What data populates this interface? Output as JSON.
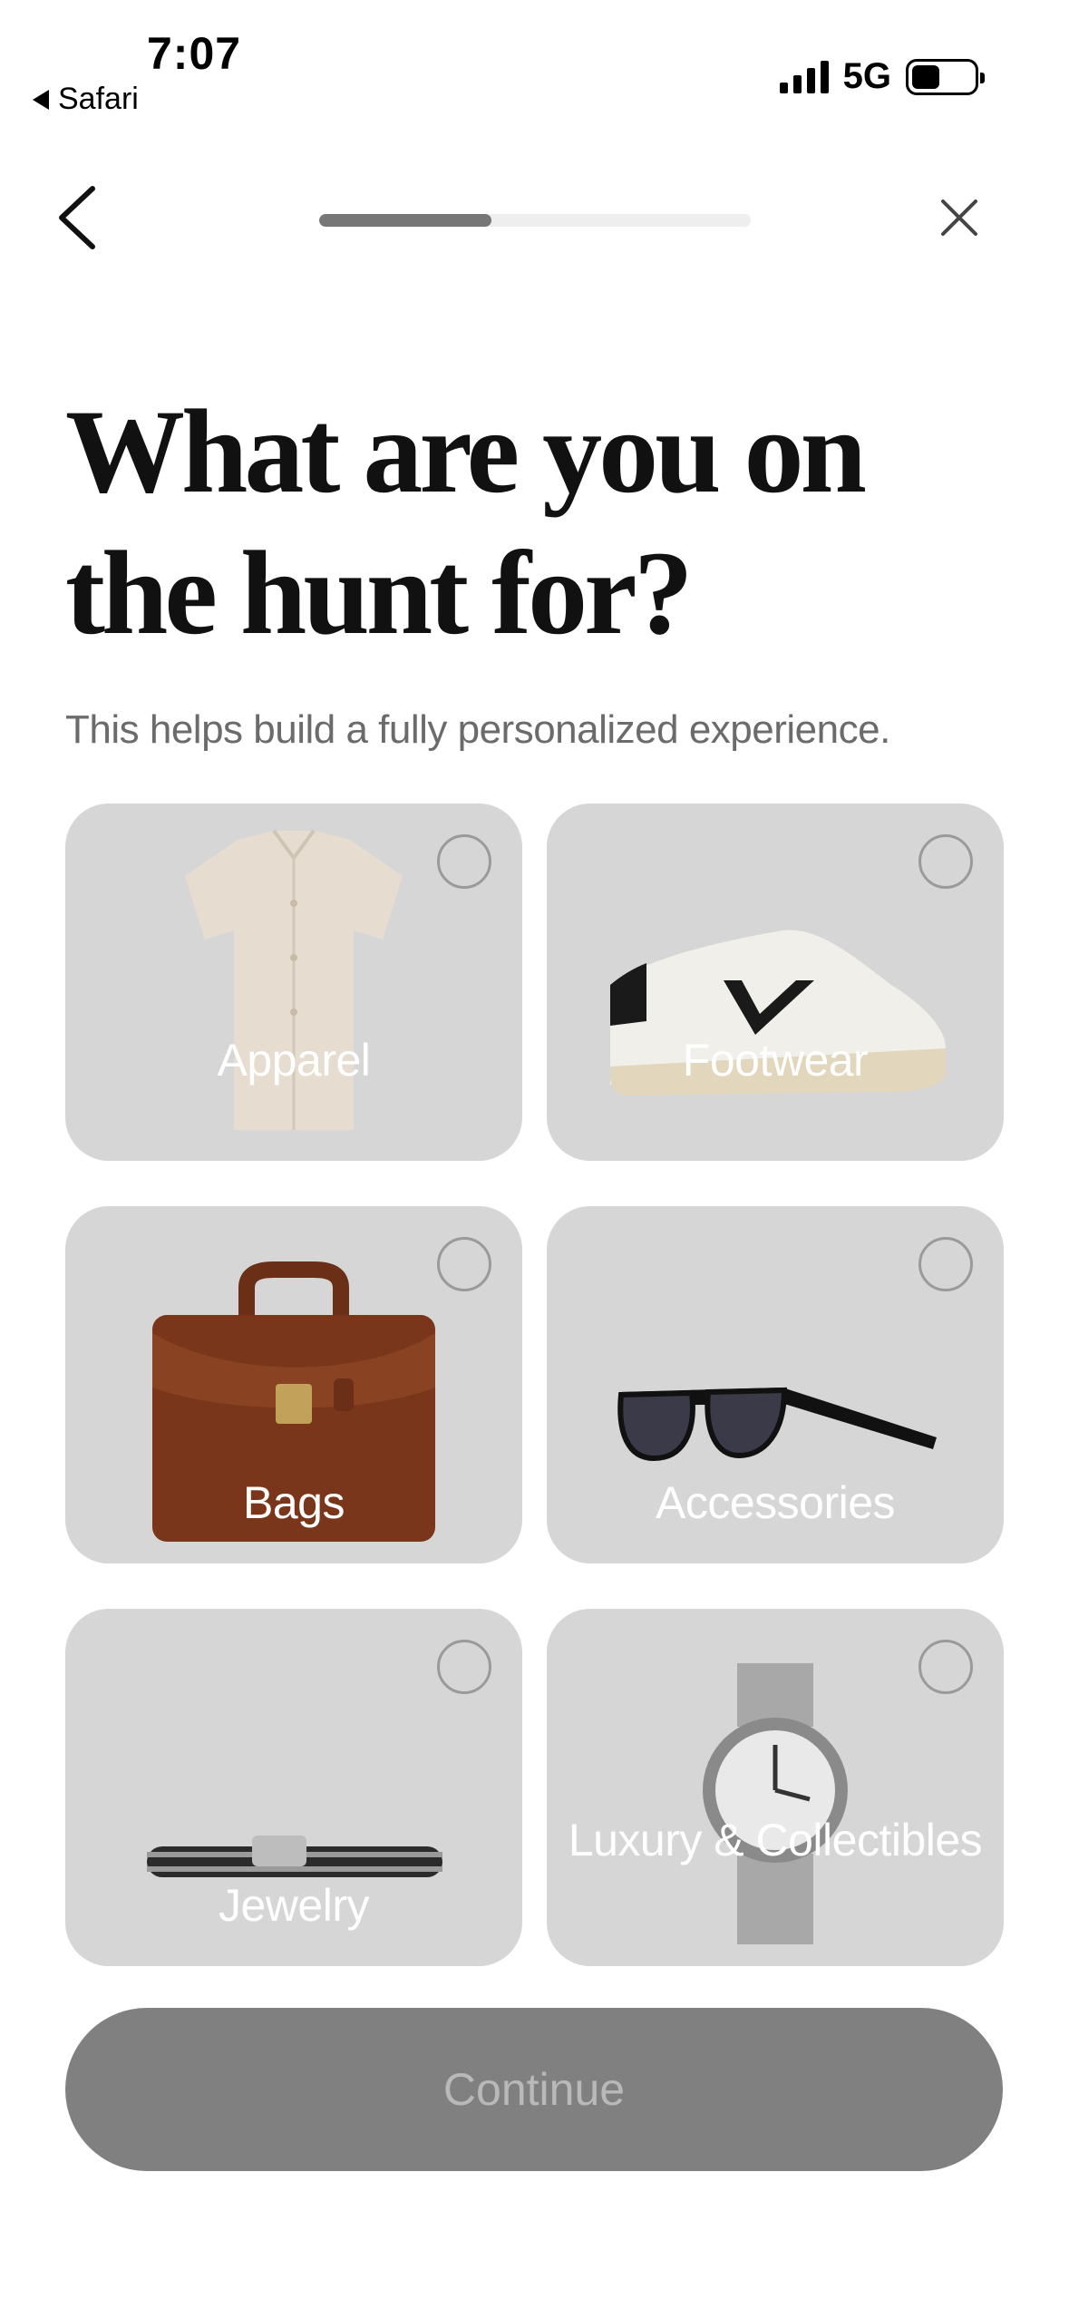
{
  "status_bar": {
    "time": "7:07",
    "back_app": "Safari",
    "network": "5G",
    "battery_level": 0.45
  },
  "nav": {
    "back_icon": "chevron-left-icon",
    "close_icon": "close-icon",
    "progress": 0.4
  },
  "header": {
    "title": "What are you on the hunt for?",
    "subtitle": "This helps build a fully personalized experience."
  },
  "categories": [
    {
      "label": "Apparel",
      "icon": "shirt-icon",
      "selected": false
    },
    {
      "label": "Footwear",
      "icon": "sneaker-icon",
      "selected": false
    },
    {
      "label": "Bags",
      "icon": "briefcase-icon",
      "selected": false
    },
    {
      "label": "Accessories",
      "icon": "sunglasses-icon",
      "selected": false
    },
    {
      "label": "Jewelry",
      "icon": "bracelet-icon",
      "selected": false
    },
    {
      "label": "Luxury & Collectibles",
      "icon": "watch-icon",
      "selected": false
    }
  ],
  "footer": {
    "continue_label": "Continue"
  },
  "colors": {
    "tile_bg": "#d6d6d6",
    "button_disabled_bg": "#808080",
    "button_disabled_text": "#b9b9b9",
    "progress_fill": "#777777",
    "progress_track": "#eeeeee"
  }
}
